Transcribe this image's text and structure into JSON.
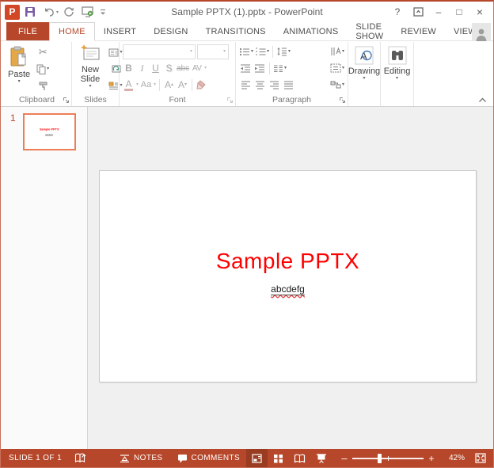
{
  "window": {
    "title": "Sample PPTX (1).pptx - PowerPoint"
  },
  "icons": {
    "ppt_logo_letter": "P",
    "caret_down": "▾",
    "scissors": "✂",
    "help": "?",
    "minimize": "–",
    "maximize": "□",
    "close": "×",
    "zoom_out": "–",
    "zoom_in": "+"
  },
  "tabs": {
    "file": "FILE",
    "active_tab": "HOME",
    "items": [
      "HOME",
      "INSERT",
      "DESIGN",
      "TRANSITIONS",
      "ANIMATIONS",
      "SLIDE SHOW",
      "REVIEW",
      "VIEW"
    ]
  },
  "ribbon": {
    "clipboard": {
      "label": "Clipboard",
      "paste_label": "Paste"
    },
    "slides": {
      "label": "Slides",
      "new_slide_label": "New Slide"
    },
    "font": {
      "label": "Font",
      "bold": "B",
      "italic": "I",
      "underline": "U",
      "shadow": "S",
      "strikethrough": "abc",
      "char_spacing": "AV",
      "font_color": "A",
      "change_case": "Aa",
      "grow_font": "A",
      "shrink_font": "A"
    },
    "paragraph": {
      "label": "Paragraph"
    },
    "drawing": {
      "label": "Drawing"
    },
    "editing": {
      "label": "Editing"
    }
  },
  "slide_panel": {
    "slide_number": "1"
  },
  "slide": {
    "title": "Sample PPTX",
    "body_text": "abcdefg"
  },
  "status_bar": {
    "slide_counter": "SLIDE 1 OF 1",
    "notes_label": "NOTES",
    "comments_label": "COMMENTS",
    "zoom_level": "42%"
  },
  "colors": {
    "accent": "#B7472A",
    "file_tab_bg": "#B7472A",
    "active_tab_text": "#B7472A",
    "status_bar_bg": "#B7472A",
    "selected_view_bg": "#993C22",
    "slide_title_red": "#FF0000",
    "thumbnail_border": "#ED7D57",
    "ppt_logo_orange": "#D24726",
    "save_icon_purple": "#7C5BA6"
  }
}
